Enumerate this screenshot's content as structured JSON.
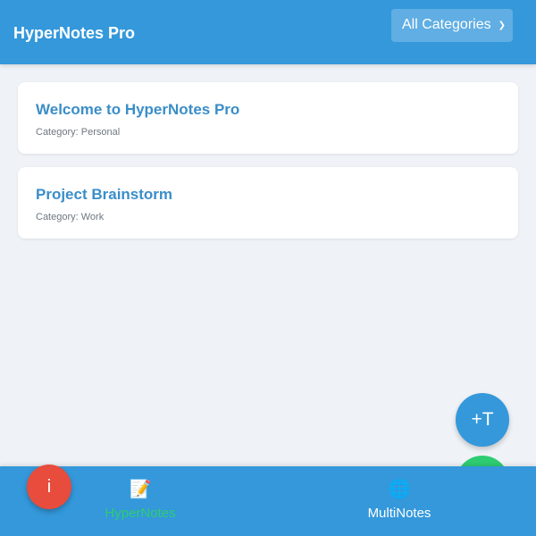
{
  "header": {
    "title": "HyperNotes Pro",
    "category_filter": {
      "selected": "All Categories",
      "icon": "chevron-down-icon"
    }
  },
  "notes": [
    {
      "title": "Welcome to HyperNotes Pro",
      "category": "Category: Personal"
    },
    {
      "title": "Project Brainstorm",
      "category": "Category: Work"
    }
  ],
  "fab": {
    "add_text_label": "+T",
    "info_label": "i"
  },
  "bottom_nav": {
    "items": [
      {
        "label": "HyperNotes",
        "icon": "memo-icon",
        "icon_glyph": "📝"
      },
      {
        "label": "MultiNotes",
        "icon": "globe-icon",
        "icon_glyph": "🌐"
      }
    ]
  },
  "colors": {
    "primary": "#3498db",
    "active_nav": "#2ecc71",
    "info_button": "#e74c3c",
    "note_title": "#3a8ec8"
  }
}
